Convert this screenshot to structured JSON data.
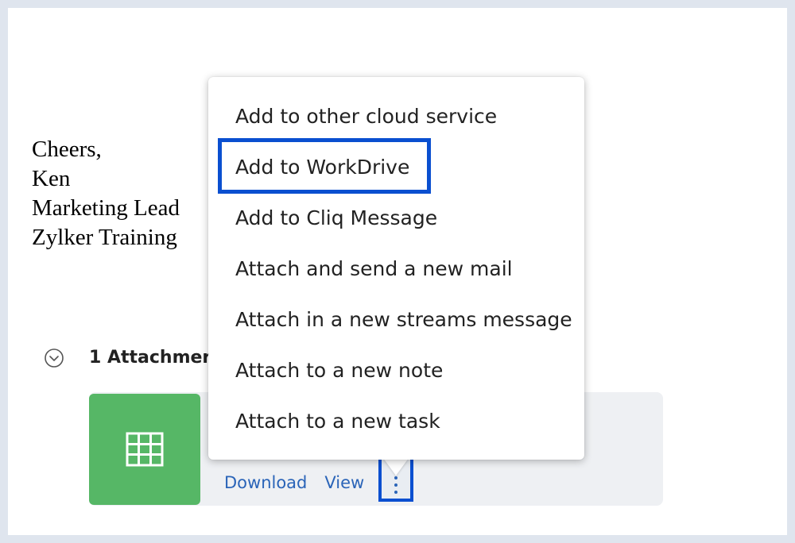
{
  "signature": {
    "lines": [
      "Cheers,",
      "Ken",
      "Marketing Lead",
      "Zylker Training"
    ]
  },
  "attachments": {
    "count_label": "1 Attachmer",
    "file": {
      "icon": "spreadsheet-grid-icon",
      "thumb_color": "#56b766",
      "download_label": "Download",
      "view_label": "View"
    }
  },
  "context_menu": {
    "items": [
      {
        "label": "Add to other cloud service"
      },
      {
        "label": "Add to WorkDrive",
        "highlighted": true
      },
      {
        "label": "Add to Cliq Message"
      },
      {
        "label": "Attach and send a new mail"
      },
      {
        "label": "Attach in a new streams message"
      },
      {
        "label": "Attach to a new note"
      },
      {
        "label": "Attach to a new task"
      }
    ]
  },
  "colors": {
    "highlight": "#0a4fd0",
    "link": "#2a64b8"
  }
}
